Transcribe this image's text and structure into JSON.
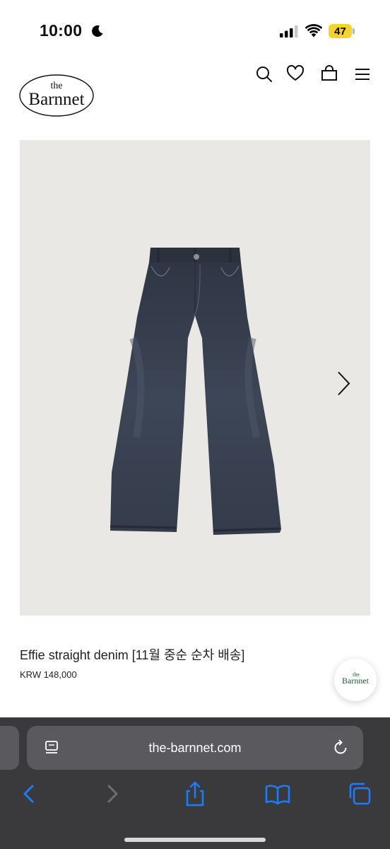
{
  "status_bar": {
    "time": "10:00",
    "battery_level": "47",
    "icons": [
      "moon-icon",
      "signal-icon",
      "wifi-icon",
      "battery-icon"
    ]
  },
  "header": {
    "logo_top": "the",
    "logo_main": "Barnnet",
    "icons": [
      "search-icon",
      "heart-icon",
      "bag-icon",
      "menu-icon"
    ]
  },
  "product": {
    "image_subject": "jeans-image",
    "title": "Effie straight denim [11월 중순 순차 배송]",
    "price": "KRW 148,000"
  },
  "floating_badge": {
    "logo_top": "the",
    "logo_main": "Barnnet"
  },
  "browser": {
    "url": "the-barnnet.com",
    "icons": [
      "tabs-overview-icon",
      "reload-icon",
      "back-icon",
      "forward-icon",
      "share-icon",
      "bookmarks-icon",
      "tabs-icon"
    ]
  },
  "colors": {
    "accent": "#1a7cff",
    "browser_bar": "#3a3a3d",
    "url_pill": "#5a5a5e",
    "image_bg": "#e9e8e4",
    "denim": "#3b4352",
    "battery": "#f6d32a",
    "logo_green": "#1f5d3a"
  }
}
